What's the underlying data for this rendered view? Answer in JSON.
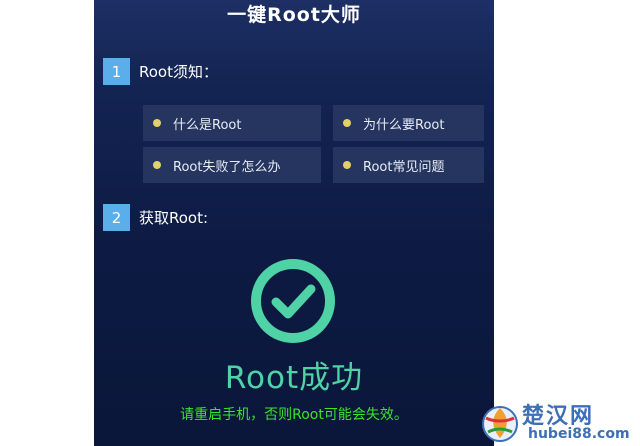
{
  "app": {
    "title": "一键Root大师"
  },
  "sections": [
    {
      "number": "1",
      "label": "Root须知："
    },
    {
      "number": "2",
      "label": "获取Root:"
    }
  ],
  "faq": [
    {
      "label": "什么是Root"
    },
    {
      "label": "为什么要Root"
    },
    {
      "label": "Root失败了怎么办"
    },
    {
      "label": "Root常见问题"
    }
  ],
  "result": {
    "status": "Root成功",
    "notice": "请重启手机，否则Root可能会失效。",
    "icon": "check-circle-icon",
    "color": "#4fd2a6"
  },
  "colors": {
    "badge": "#5aaee9",
    "bullet": "#e3cf6e",
    "notice": "#39e42a",
    "button_bg": "#25355f"
  },
  "watermark": {
    "name": "楚汉网",
    "url": "hubei88.com"
  }
}
